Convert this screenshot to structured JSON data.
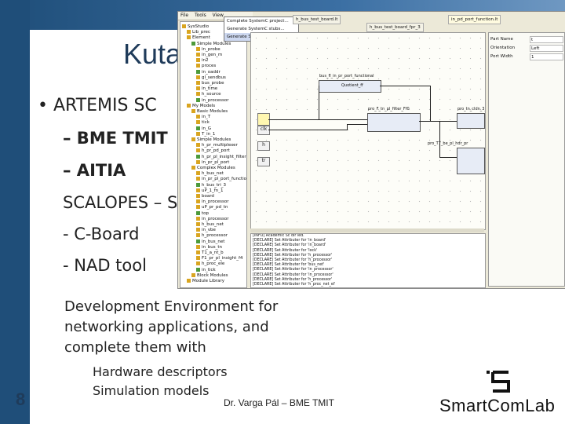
{
  "slide": {
    "title": "Kuta",
    "bullet": "• ARTEMIS SC",
    "sub1": "– BME TMIT",
    "sub2": "– AITIA",
    "line3": "SCALOPES – S",
    "item1": "- C-Board",
    "item2": "- NAD tool",
    "para_lines": [
      "Development Environment for",
      "networking applications, and",
      "complete them with"
    ],
    "para2_lines": [
      "Hardware descriptors",
      "Simulation models"
    ],
    "slide_number": "8",
    "author": "Dr. Varga Pál – BME TMIT",
    "logo": "SmartComLab"
  },
  "app": {
    "menu": [
      "File",
      "Tools",
      "View"
    ],
    "context_menu": [
      "Complete SystemC project...",
      "Generate SystemC stubs...",
      "Generate SystemC pro..."
    ],
    "tree": [
      "SysStudio",
      "Lib_prec",
      "Element",
      "Simple Modules",
      "in_probe",
      "in_gen_m",
      "in2",
      "proces",
      "in_oaddr",
      "gl_sendbus",
      "bus_probe",
      "in_time",
      "h_source",
      "in_processor",
      "My Models",
      "Basic Modules",
      "in_T",
      "tick",
      "in_G",
      "T_in_1",
      "Simple Modules",
      "h_pr_multiplexer",
      "h_pr_pd_port",
      "h_pr_pl_insight_filter",
      "in_pr_pl_port",
      "Complex Modules",
      "h_bus_net",
      "in_pr_pl_port_function",
      "h_bus_tri_3",
      "uP_1_fn_1",
      "board",
      "in_processor",
      "uP_pr_pd_tn",
      "top",
      "in_processor",
      "h_bus_net",
      "in_vbe",
      "h_processor",
      "in_bus_net",
      "in_bus_tn",
      "T1_a_nt_b",
      "F1_pr_pl_insight_f4",
      "h_proc_ele",
      "in_tick",
      "Block Modules",
      "Module Library"
    ],
    "tabs": [
      "h_bus_test_board.lt",
      "h_bus_test_board_fpr_3",
      "in_pd_port_function.lt"
    ],
    "block1_title": "bus_fl_in_pr_port_functional",
    "block1_inner": "Quotient_ff",
    "block2_title": "pro_F_tn_pl_filter_Ff0",
    "block3_title": "pro_tn_cldn_3_ghz",
    "block4_title": "pro_T7_be_pl_hdr_pr",
    "gbox_labels": [
      "clk",
      "h",
      "tr"
    ],
    "props": [
      {
        "key": "Part Name",
        "value": "t"
      },
      {
        "key": "Orientation",
        "value": "Left"
      },
      {
        "key": "Port Width",
        "value": "1"
      }
    ],
    "log": [
      "[INFO] Academic Sc dir led.",
      "[DECLARE] Set Attributer for 'in_board'",
      "[DECLARE] Set Attributer for 'in_board'",
      "[DECLARE] Set Attributer for 'lock'",
      "[DECLARE] Set Attributer for 'h_processor'",
      "[DECLARE] Set Attributer for 'h_processor'",
      "[DECLARE] Set Attributer for 'bus_net'",
      "[DECLARE] Set Attributer for 'in_processor'",
      "[DECLARE] Set Attributer for 'in_processor'",
      "[DECLARE] Set Attributer for 'h_processor'",
      "[DECLARE] Set Attributer for 'h_proc_net_el'"
    ]
  }
}
